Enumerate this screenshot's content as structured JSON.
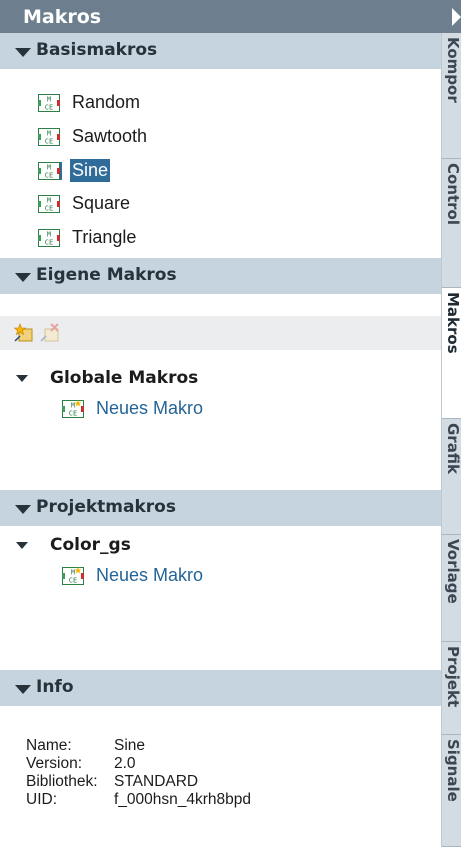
{
  "header": {
    "title": "Makros"
  },
  "sections": {
    "basis": {
      "title": "Basismakros",
      "items": [
        {
          "label": "Random"
        },
        {
          "label": "Sawtooth"
        },
        {
          "label": "Sine",
          "selected": true
        },
        {
          "label": "Square"
        },
        {
          "label": "Triangle"
        }
      ]
    },
    "eigene": {
      "title": "Eigene Makros",
      "toolbar": {
        "new_icon": "new-macro-icon",
        "delete_icon": "delete-macro-icon"
      },
      "group": {
        "label": "Globale Makros",
        "items": [
          {
            "label": "Neues Makro"
          }
        ]
      }
    },
    "projekt": {
      "title": "Projektmakros",
      "group": {
        "label": "Color_gs",
        "items": [
          {
            "label": "Neues Makro"
          }
        ]
      }
    },
    "info": {
      "title": "Info",
      "rows": [
        {
          "key": "Name:",
          "value": "Sine"
        },
        {
          "key": "Version:",
          "value": "2.0"
        },
        {
          "key": "Bibliothek:",
          "value": "STANDARD"
        },
        {
          "key": "UID:",
          "value": "f_000hsn_4krh8bpd"
        }
      ]
    }
  },
  "side_tabs": [
    {
      "label": "Kompor"
    },
    {
      "label": "Control"
    },
    {
      "label": "Makros",
      "active": true
    },
    {
      "label": "Grafik"
    },
    {
      "label": "Vorlage"
    },
    {
      "label": "Projekt"
    },
    {
      "label": "Signale"
    }
  ],
  "colors": {
    "titlebar": "#6d7f8e",
    "section_header": "#c6d4df",
    "selection": "#2f6c9a",
    "link": "#246497"
  }
}
